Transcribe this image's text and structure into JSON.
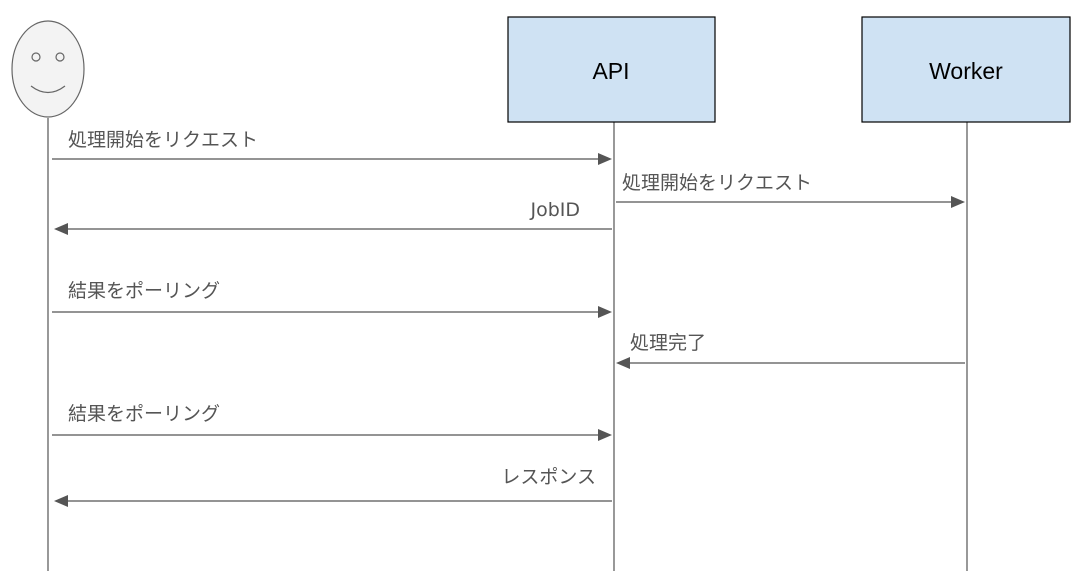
{
  "actor": {
    "icon": "smiley-face-icon"
  },
  "participants": [
    {
      "id": "api",
      "label": "API"
    },
    {
      "id": "worker",
      "label": "Worker"
    }
  ],
  "messages": [
    {
      "id": "m1",
      "from": "user",
      "to": "api",
      "label": "処理開始をリクエスト"
    },
    {
      "id": "m2",
      "from": "api",
      "to": "worker",
      "label": "処理開始をリクエスト"
    },
    {
      "id": "m3",
      "from": "api",
      "to": "user",
      "label": "JobID"
    },
    {
      "id": "m4",
      "from": "user",
      "to": "api",
      "label": "結果をポーリング"
    },
    {
      "id": "m5",
      "from": "worker",
      "to": "api",
      "label": "処理完了"
    },
    {
      "id": "m6",
      "from": "user",
      "to": "api",
      "label": "結果をポーリング"
    },
    {
      "id": "m7",
      "from": "api",
      "to": "user",
      "label": "レスポンス"
    }
  ],
  "colors": {
    "participant_fill": "#cfe2f3",
    "participant_border": "#000000",
    "line": "#555555",
    "text": "#555555"
  }
}
